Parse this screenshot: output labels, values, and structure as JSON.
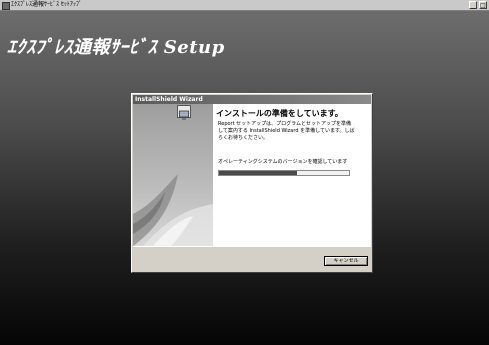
{
  "outer_window": {
    "title": "ｴｸｽﾌﾟﾚｽ通報ｻｰﾋﾞｽ ｾｯﾄｱｯﾌﾟ",
    "minimize_label": "_",
    "maximize_label": "□"
  },
  "setup_heading": "ｴｸｽﾌﾟﾚｽ通報ｻｰﾋﾞｽ  Setup",
  "dialog": {
    "title": "InstallShield Wizard",
    "heading": "インストールの準備をしています。",
    "description": "Report セットアップは、プログラムとセットアップを準備して案内する InstallShield Wizard を準備しています。しばらくお待ちください。",
    "status": "オペレーティングシステムのバージョンを確認しています",
    "progress": 0.6,
    "cancel_label": "キャンセル"
  }
}
